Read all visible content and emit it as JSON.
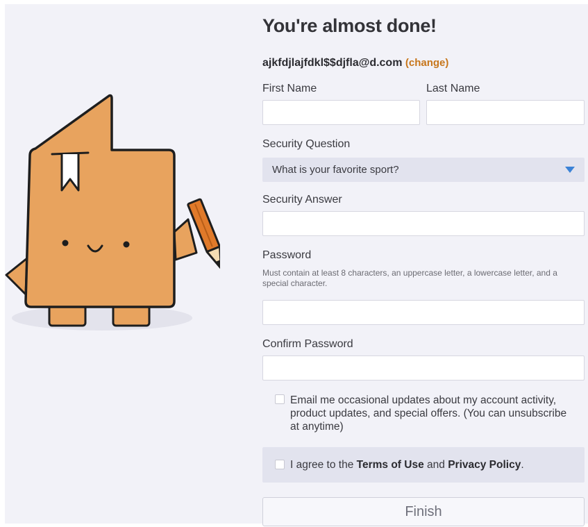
{
  "form": {
    "title": "You're almost done!",
    "email": "ajkfdjlajfdkl$$djfla@d.com",
    "change_label": "(change)",
    "first_name_label": "First Name",
    "last_name_label": "Last Name",
    "first_name_value": "",
    "last_name_value": "",
    "security_question_label": "Security Question",
    "security_question_selected": "What is your favorite sport?",
    "security_answer_label": "Security Answer",
    "security_answer_value": "",
    "password_label": "Password",
    "password_hint": "Must contain at least 8 characters, an uppercase letter, a lowercase letter, and a special character.",
    "password_value": "",
    "confirm_password_label": "Confirm Password",
    "confirm_password_value": "",
    "email_updates_label": "Email me occasional updates about my account activity, product updates, and special offers. (You can unsubscribe at anytime)",
    "email_updates_checked": false,
    "agree_prefix": "I agree to the ",
    "agree_terms": "Terms of Use",
    "agree_and": " and ",
    "agree_privacy": "Privacy Policy",
    "agree_suffix": ".",
    "agree_checked": false,
    "finish_label": "Finish"
  },
  "colors": {
    "page_background": "#f2f2f8",
    "mascot_fill": "#e8a35e",
    "pencil": "#e07a2a",
    "link": "#c7761b",
    "dropdown_arrow": "#3b82d6",
    "select_background": "#e2e3ee"
  },
  "icons": {
    "mascot": "document-mascot-with-pencil",
    "dropdown": "triangle-down-icon"
  }
}
